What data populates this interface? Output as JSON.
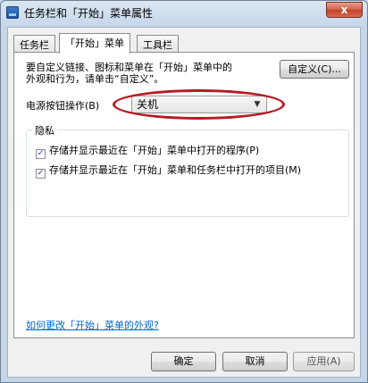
{
  "window": {
    "title": "任务栏和「开始」菜单属性",
    "close_label": "x"
  },
  "tabs": [
    {
      "label": "任务栏",
      "active": false
    },
    {
      "label": "「开始」菜单",
      "active": true
    },
    {
      "label": "工具栏",
      "active": false
    }
  ],
  "start_menu": {
    "description_line1": "要自定义链接、图标和菜单在「开始」菜单中的",
    "description_line2": "外观和行为，请单击“自定义”。",
    "customize_button": "自定义(C)...",
    "power_label": "电源按钮操作(B)",
    "power_value": "关机"
  },
  "privacy": {
    "title": "隐私",
    "items": [
      {
        "label": "存储并显示最近在「开始」菜单中打开的程序(P)",
        "checked": true
      },
      {
        "label": "存储并显示最近在「开始」菜单和任务栏中打开的项目(M)",
        "checked": true
      }
    ]
  },
  "help_link": "如何更改「开始」菜单的外观?",
  "buttons": {
    "ok": "确定",
    "cancel": "取消",
    "apply": "应用(A)"
  },
  "colors": {
    "highlight_ellipse": "#b51c22",
    "link": "#0066cc"
  }
}
